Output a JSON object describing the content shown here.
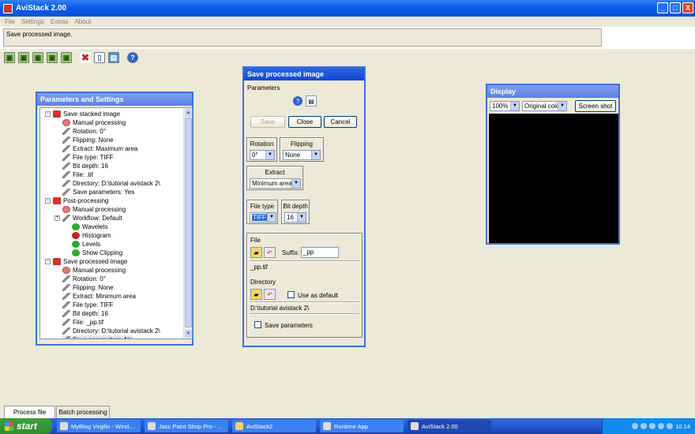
{
  "window": {
    "title": "AviStack 2.00",
    "controls": {
      "minimize": "_",
      "maximize": "□",
      "close": "X"
    }
  },
  "menu": [
    "File",
    "Settings",
    "Extras",
    "About"
  ],
  "status_text": "Save processed image.",
  "toolbar_icons": [
    "open-video-icon",
    "open-images-icon",
    "open-frames-icon",
    "load-icon",
    "load-all-icon",
    "delete-icon",
    "new-doc-icon",
    "save-icon",
    "help-icon"
  ],
  "params_window": {
    "title": "Parameters and Settings",
    "rows": [
      {
        "label": "Save stacked image",
        "icon": "folder",
        "level": 0
      },
      {
        "label": "Manual processing",
        "icon": "gear",
        "level": 1
      },
      {
        "label": "Rotation: 0°",
        "icon": "wrench",
        "level": 1
      },
      {
        "label": "Flipping: None",
        "icon": "wrench",
        "level": 1
      },
      {
        "label": "Extract: Maximum area",
        "icon": "wrench",
        "level": 1
      },
      {
        "label": "File type: TIFF",
        "icon": "wrench",
        "level": 1
      },
      {
        "label": "Bit depth: 16",
        "icon": "wrench",
        "level": 1
      },
      {
        "label": "File: .tif",
        "icon": "wrench",
        "level": 1
      },
      {
        "label": "Directory: D:\\tutorial avistack 2\\",
        "icon": "wrench",
        "level": 1
      },
      {
        "label": "Save parameters: Yes",
        "icon": "wrench",
        "level": 1
      },
      {
        "label": "Post-processing",
        "icon": "folder",
        "level": 0
      },
      {
        "label": "Manual processing",
        "icon": "gear",
        "level": 1
      },
      {
        "label": "Workflow: Default",
        "icon": "wrench",
        "level": 1
      },
      {
        "label": "Wavelets",
        "icon": "check",
        "level": 2
      },
      {
        "label": "Histogram",
        "icon": "xmark",
        "level": 2
      },
      {
        "label": "Levels",
        "icon": "check",
        "level": 2
      },
      {
        "label": "Show Clipping",
        "icon": "check",
        "level": 2
      },
      {
        "label": "Save processed image",
        "icon": "folder",
        "level": 0
      },
      {
        "label": "Manual processing",
        "icon": "gear",
        "level": 1
      },
      {
        "label": "Rotation: 0°",
        "icon": "wrench",
        "level": 1
      },
      {
        "label": "Flipping: None",
        "icon": "wrench",
        "level": 1
      },
      {
        "label": "Extract: Minimum area",
        "icon": "wrench",
        "level": 1
      },
      {
        "label": "File type: TIFF",
        "icon": "wrench",
        "level": 1
      },
      {
        "label": "Bit depth: 16",
        "icon": "wrench",
        "level": 1
      },
      {
        "label": "File: _pp.tif",
        "icon": "wrench",
        "level": 1
      },
      {
        "label": "Directory: D:\\tutorial avistack 2\\",
        "icon": "wrench",
        "level": 1
      },
      {
        "label": "Save parameters: No",
        "icon": "wrench",
        "level": 1,
        "selected": true
      }
    ]
  },
  "save_dialog": {
    "title": "Save processed image",
    "parameters_label": "Parameters",
    "save_label": "Save",
    "close_label": "Close",
    "cancel_label": "Cancel",
    "rotation": {
      "label": "Rotation",
      "value": "0°"
    },
    "flipping": {
      "label": "Flipping",
      "value": "None"
    },
    "extract": {
      "label": "Extract",
      "value": "Minimum area"
    },
    "file_type": {
      "label": "File type",
      "value": "TIFF"
    },
    "bit_depth": {
      "label": "Bit depth",
      "value": "16"
    },
    "file_label": "File",
    "suffix_label": "Suffix:",
    "suffix_value": "_pp",
    "file_result": "_pp.tif",
    "directory_label": "Directory",
    "use_default_label": "Use as default",
    "directory_value": "D:\\tutorial avistack 2\\",
    "save_params_label": "Save parameters"
  },
  "display_window": {
    "title": "Display",
    "zoom": "100%",
    "color_mode": "Original color",
    "screenshot_label": "Screen shot"
  },
  "bottom_tabs": [
    "Process file",
    "Batch processing"
  ],
  "taskbar": {
    "start_label": "start",
    "tasks": [
      "MyBlog Virgilio - Wind...",
      "Jasc Paint Shop Pro - ...",
      "AviStack2",
      "Runtime App",
      "AviStack 2.00"
    ],
    "language": "IT",
    "clock": "10.14"
  }
}
